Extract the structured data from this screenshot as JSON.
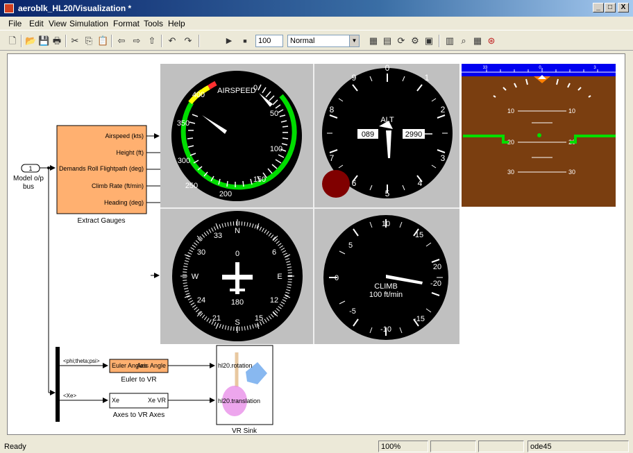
{
  "window": {
    "title": "aeroblk_HL20/Visualization *",
    "minimize": "_",
    "maximize": "□",
    "close": "X"
  },
  "menu": [
    "File",
    "Edit",
    "View",
    "Simulation",
    "Format",
    "Tools",
    "Help"
  ],
  "toolbar": {
    "stop_time": "100",
    "sim_mode": "Normal"
  },
  "blocks": {
    "inport": {
      "number": "1",
      "label_line1": "Model o/p",
      "label_line2": "bus"
    },
    "extract": {
      "name": "Extract Gauges",
      "outputs": [
        "Airspeed (kts)",
        "Height (ft)",
        "Demands  Roll Flightpath (deg)",
        "Climb Rate (ft/min)",
        "Heading (deg)"
      ]
    },
    "euler": {
      "name": "Euler to VR",
      "in_port": "Euler Angles",
      "out_port": "Axis Angle"
    },
    "axes": {
      "name": "Axes to VR Axes",
      "in_port": "Xe",
      "out_port": "Xe VR"
    },
    "vrsink": {
      "name": "VR Sink",
      "in1": "hl20.rotation",
      "in2": "hl20.translation"
    },
    "signals": {
      "sig1": "<phi;theta;psi>",
      "sig2": "<Xe>"
    }
  },
  "gauges": {
    "airspeed": {
      "title": "AIRSPEED",
      "ticks": [
        "0",
        "50",
        "100",
        "150",
        "200",
        "250",
        "300",
        "350",
        "400"
      ]
    },
    "altimeter": {
      "title": "ALT",
      "ticks": [
        "0",
        "1",
        "2",
        "3",
        "4",
        "5",
        "6",
        "7",
        "8",
        "9"
      ],
      "drum_left": "089",
      "drum_right": "2990"
    },
    "heading": {
      "letters": [
        "N",
        "E",
        "S",
        "W"
      ],
      "numbers": [
        "33",
        "30",
        "6",
        "12",
        "15",
        "21",
        "24",
        "0",
        "180"
      ]
    },
    "climb": {
      "title": "CLIMB",
      "unit": "100 ft/min",
      "ticks": [
        "10",
        "15",
        "20",
        "-20",
        "-15",
        "-10",
        "-5",
        "0",
        "5"
      ]
    },
    "horizon": {
      "ladder_left": [
        "10",
        "20",
        "30"
      ],
      "ladder_right": [
        "10",
        "20",
        "30"
      ],
      "roll_scale": [
        "33",
        "0",
        "3"
      ]
    }
  },
  "status": {
    "ready": "Ready",
    "zoom": "100%",
    "solver": "ode45"
  },
  "colors": {
    "orange_block": "#ffb070",
    "gauge_bg": "#c0c0c0",
    "sky": "#0000f0",
    "ground": "#7a3e10",
    "green": "#00dd00"
  }
}
